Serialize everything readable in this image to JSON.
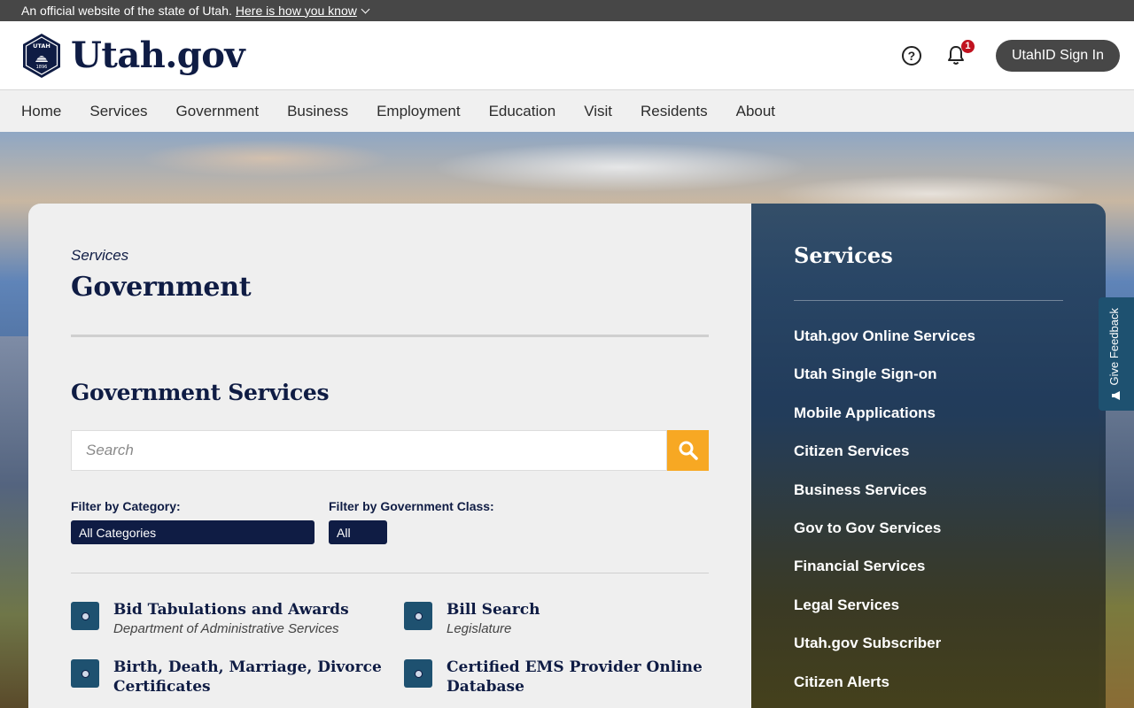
{
  "banner": {
    "text": "An official website of the state of Utah.",
    "link": "Here is how you know"
  },
  "header": {
    "logo_text": "Utah.gov",
    "seal_text": "UTAH",
    "seal_year": "1896",
    "notification_count": "1",
    "signin_label": "UtahID Sign In"
  },
  "nav": {
    "items": [
      {
        "label": "Home"
      },
      {
        "label": "Services"
      },
      {
        "label": "Government"
      },
      {
        "label": "Business"
      },
      {
        "label": "Employment"
      },
      {
        "label": "Education"
      },
      {
        "label": "Visit"
      },
      {
        "label": "Residents"
      },
      {
        "label": "About"
      }
    ]
  },
  "main": {
    "breadcrumb": "Services",
    "title": "Government",
    "section_title": "Government Services",
    "search_placeholder": "Search",
    "filters": {
      "category_label": "Filter by Category:",
      "category_value": "All Categories",
      "class_label": "Filter by Government Class:",
      "class_value": "All"
    },
    "services": [
      {
        "name": "Bid Tabulations and Awards",
        "dept": "Department of Administrative Services"
      },
      {
        "name": "Bill Search",
        "dept": "Legislature"
      },
      {
        "name": "Birth, Death, Marriage, Divorce Certificates",
        "dept": ""
      },
      {
        "name": "Certified EMS Provider Online Database",
        "dept": ""
      }
    ]
  },
  "sidebar": {
    "title": "Services",
    "items": [
      {
        "label": "Utah.gov Online Services"
      },
      {
        "label": "Utah Single Sign-on"
      },
      {
        "label": "Mobile Applications"
      },
      {
        "label": "Citizen Services"
      },
      {
        "label": "Business Services"
      },
      {
        "label": "Gov to Gov Services"
      },
      {
        "label": "Financial Services"
      },
      {
        "label": "Legal Services"
      },
      {
        "label": "Utah.gov Subscriber"
      },
      {
        "label": "Citizen Alerts"
      }
    ]
  },
  "feedback": {
    "label": "Give Feedback"
  },
  "colors": {
    "brand_navy": "#0f1c44",
    "search_accent": "#f7a823",
    "banner_gray": "#474747",
    "service_icon": "#1e5170",
    "badge_red": "#c1121f"
  },
  "icons": {
    "help": "question-circle-icon",
    "notifications": "bell-icon",
    "search": "magnifier-icon",
    "service": "utah-seal-icon",
    "banner_toggle": "chevron-down-icon",
    "feedback": "megaphone-icon"
  }
}
